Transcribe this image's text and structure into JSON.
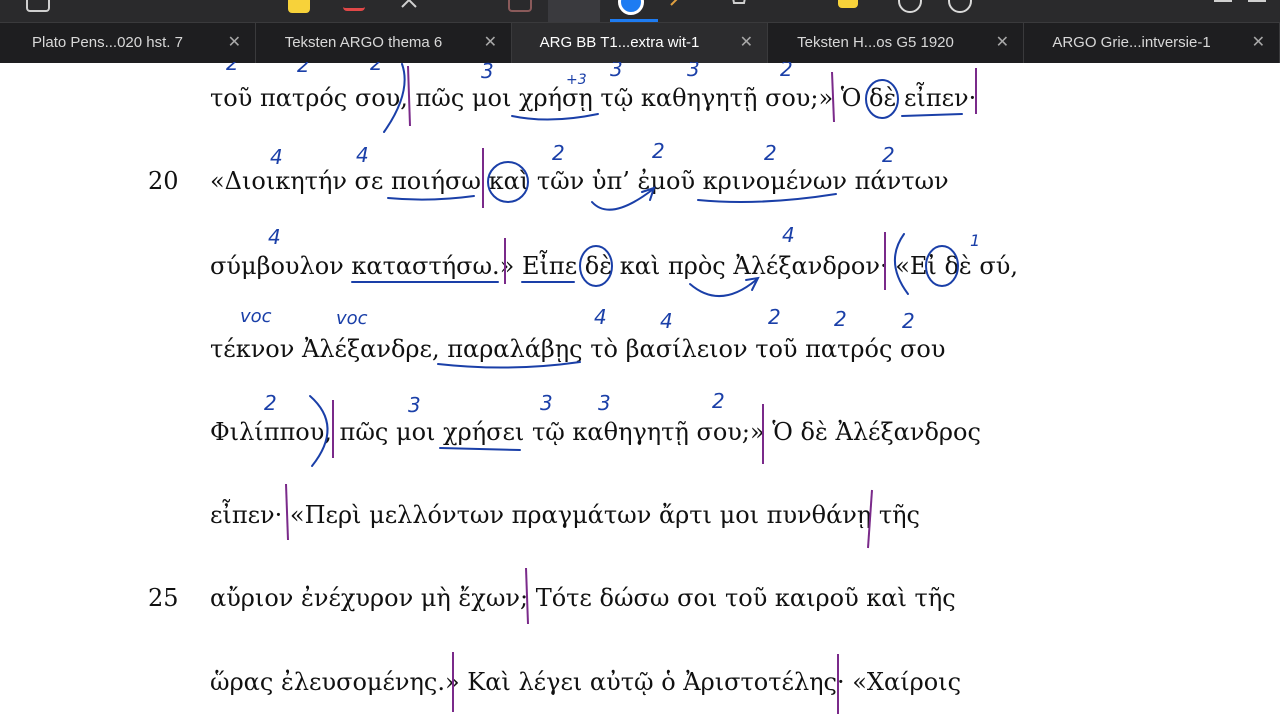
{
  "toolbar": {
    "icons": [
      "pen-icon",
      "eraser-icon",
      "lasso-icon",
      "shapes-icon",
      "highlighter-icon",
      "color-icon",
      "marker-icon",
      "tag-icon",
      "star-icon",
      "undo-icon",
      "redo-icon",
      "menu-icon"
    ]
  },
  "tabs": [
    {
      "label": "Plato Pens...020 hst. 7",
      "close": "✕",
      "active": false
    },
    {
      "label": "Teksten ARGO thema 6",
      "close": "✕",
      "active": false
    },
    {
      "label": "ARG BB T1...extra wit-1",
      "close": "✕",
      "active": true
    },
    {
      "label": "Teksten H...os G5 1920",
      "close": "✕",
      "active": false
    },
    {
      "label": "ARGO Grie...intversie-1",
      "close": "✕",
      "active": false
    }
  ],
  "document": {
    "lines": [
      "τοῦ πατρός σου, πῶς μοι χρήσῃ τῷ καθηγητῇ σου;» Ὁ δὲ εἶπεν·",
      "«Διοικητήν σε ποιήσω καὶ τῶν ὑπ’ ἐμοῦ κρινομένων πάντων",
      "σύμβουλον καταστήσω.» Εἶπε δὲ καὶ πρὸς Ἀλέξανδρον· «Εἰ δὲ σύ,",
      "τέκνον Ἀλέξανδρε, παραλάβῃς τὸ βασίλειον τοῦ πατρός σου",
      "Φιλίππου, πῶς μοι χρήσει τῷ καθηγητῇ σου;» Ὁ δὲ Ἀλέξανδρος",
      "εἶπεν· «Περὶ μελλόντων πραγμάτων ἄρτι μοι πυνθάνῃ τῆς",
      "αὔριον ἐνέχυρον μὴ ἔχων; Τότε δώσω σοι τοῦ καιροῦ καὶ τῆς",
      "ὥρας ἐλευσομένης.» Καὶ λέγει αὐτῷ ὁ Ἀριστοτέλης· «Χαίροις"
    ],
    "line_numbers": [
      "20",
      "25"
    ]
  },
  "annotations": {
    "ink_color": "#1a3fa8",
    "divider_color": "#7a2a8a",
    "row1": [
      "2",
      "2",
      "2",
      "3",
      "+3",
      "3",
      "3",
      "2"
    ],
    "row2": [
      "4",
      "4",
      "2",
      "2",
      "2",
      "2"
    ],
    "row3": [
      "4",
      "4",
      "1"
    ],
    "row4": [
      "voc",
      "voc",
      "4",
      "4",
      "2",
      "2",
      "2"
    ],
    "row5": [
      "2",
      "3",
      "3",
      "3",
      "2"
    ]
  }
}
